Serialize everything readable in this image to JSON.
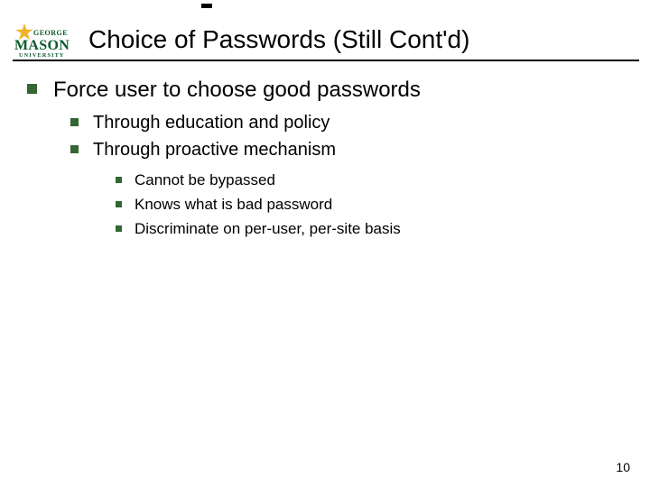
{
  "logo": {
    "line1": "GEORGE",
    "line2": "MASON",
    "line3": "UNIVERSITY",
    "star_color": "#f0b429",
    "text_color": "#0b5a2a"
  },
  "title": "Choice of Passwords (Still Cont'd)",
  "bullets": {
    "lvl1": "Force user to choose good passwords",
    "lvl2": {
      "a": "Through education and policy",
      "b": "Through proactive mechanism"
    },
    "lvl3": {
      "a": "Cannot be bypassed",
      "b": "Knows what is bad password",
      "c": "Discriminate on per-user, per-site basis"
    }
  },
  "page_number": "10",
  "bullet_color": "#336633"
}
